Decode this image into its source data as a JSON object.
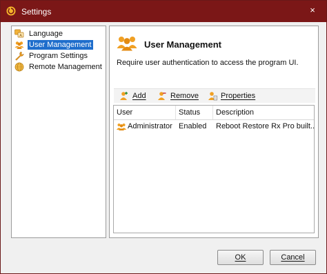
{
  "window": {
    "title": "Settings",
    "close_glyph": "×",
    "title_icon": "power-restore-icon",
    "titlebar_color": "#7b1717"
  },
  "sidebar": {
    "items": [
      {
        "label": "Language",
        "icon": "language-icon",
        "selected": false
      },
      {
        "label": "User Management",
        "icon": "users-icon",
        "selected": true
      },
      {
        "label": "Program Settings",
        "icon": "wrench-icon",
        "selected": false
      },
      {
        "label": "Remote Management",
        "icon": "globe-icon",
        "selected": false
      }
    ],
    "selection_color": "#1f6ecc"
  },
  "main": {
    "title": "User Management",
    "description": "Require user authentication to access the program UI.",
    "toolbar": {
      "add_label": "Add",
      "remove_label": "Remove",
      "properties_label": "Properties"
    },
    "table": {
      "columns": [
        "User",
        "Status",
        "Description"
      ],
      "rows": [
        {
          "user": "Administrator",
          "status": "Enabled",
          "description": "Reboot Restore Rx Pro built..."
        }
      ]
    }
  },
  "footer": {
    "ok_label": "OK",
    "cancel_label": "Cancel"
  }
}
